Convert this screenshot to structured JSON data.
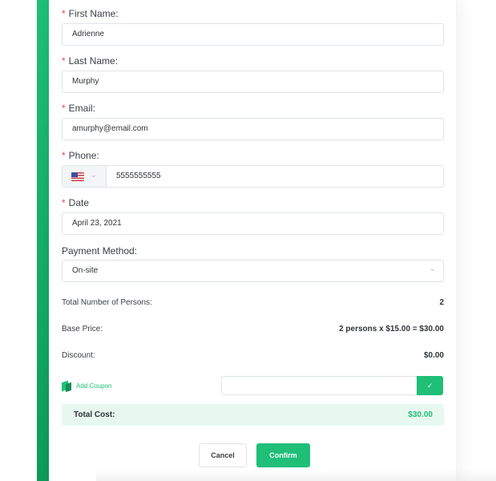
{
  "form": {
    "first_name": {
      "label": "First Name:",
      "value": "Adrienne"
    },
    "last_name": {
      "label": "Last Name:",
      "value": "Murphy"
    },
    "email": {
      "label": "Email:",
      "value": "amurphy@email.com"
    },
    "phone": {
      "label": "Phone:",
      "value": "5555555555",
      "country_flag": "us-flag-icon"
    },
    "date": {
      "label": "Date",
      "value": "April 23, 2021"
    },
    "payment": {
      "label": "Payment Method:",
      "selected": "On-site"
    },
    "required_mark": "*"
  },
  "summary": {
    "persons_label": "Total Number of Persons:",
    "persons_value": "2",
    "base_label": "Base Price:",
    "base_value": "2 persons x $15.00 = $30.00",
    "discount_label": "Discount:",
    "discount_value": "$0.00"
  },
  "coupon": {
    "link_label": "Add Coupon",
    "input_value": "",
    "apply_icon": "check-icon"
  },
  "total": {
    "label": "Total Cost:",
    "value": "$30.00"
  },
  "buttons": {
    "cancel": "Cancel",
    "confirm": "Confirm"
  },
  "colors": {
    "accent": "#1fbf78",
    "required": "#e8474c",
    "total_bg": "#e7f8f0"
  }
}
